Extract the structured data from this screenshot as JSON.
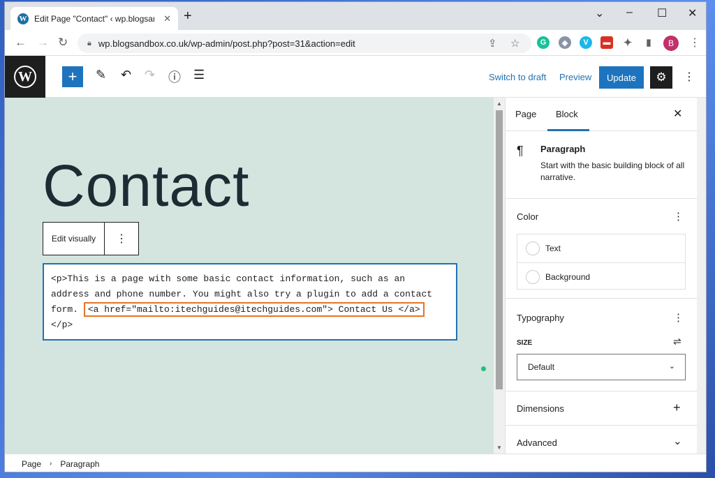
{
  "browser": {
    "tab_title": "Edit Page \"Contact\" ‹ wp.blogsandbox",
    "tab_favicon": "W",
    "new_tab": "+",
    "window_controls": [
      "⌄",
      "–",
      "☐",
      "✕"
    ],
    "url": "wp.blogsandbox.co.uk/wp-admin/post.php?post=31&action=edit",
    "profile_initial": "B",
    "extensions": [
      {
        "name": "grammarly-icon",
        "label": "G",
        "color": "#15c39a"
      },
      {
        "name": "shield-extension-icon",
        "label": "◈",
        "color": "#8a93a6"
      },
      {
        "name": "vimeo-icon",
        "label": "V",
        "color": "#1ab7ea"
      },
      {
        "name": "red-extension-icon",
        "label": "▬",
        "color": "#d93025"
      },
      {
        "name": "puzzle-icon",
        "label": "✦",
        "color": "#5f6368"
      },
      {
        "name": "sidepanel-icon",
        "label": "▮",
        "color": "#5f6368"
      }
    ]
  },
  "editor_header": {
    "switch_to_draft": "Switch to draft",
    "preview": "Preview",
    "update": "Update"
  },
  "canvas": {
    "page_title": "Contact",
    "edit_visually": "Edit visually",
    "html_lines": [
      "<p>This is a page with some basic contact information, such as an",
      "address and phone number. You might also try a plugin to add a contact",
      "form. ",
      "<a href=\"mailto:itechguides@itechguides.com\"> Contact Us </a>",
      "</p>"
    ]
  },
  "sidebar": {
    "tab_page": "Page",
    "tab_block": "Block",
    "block_name": "Paragraph",
    "block_desc": "Start with the basic building block of all narrative.",
    "color_title": "Color",
    "color_text": "Text",
    "color_background": "Background",
    "typography_title": "Typography",
    "size_label": "SIZE",
    "size_value": "Default",
    "dimensions_title": "Dimensions",
    "advanced_title": "Advanced"
  },
  "breadcrumb": {
    "items": [
      "Page",
      "Paragraph"
    ]
  },
  "colors": {
    "accent": "#2271b1",
    "canvas_bg": "#d4e5e0",
    "highlight_box": "#e4742a"
  }
}
